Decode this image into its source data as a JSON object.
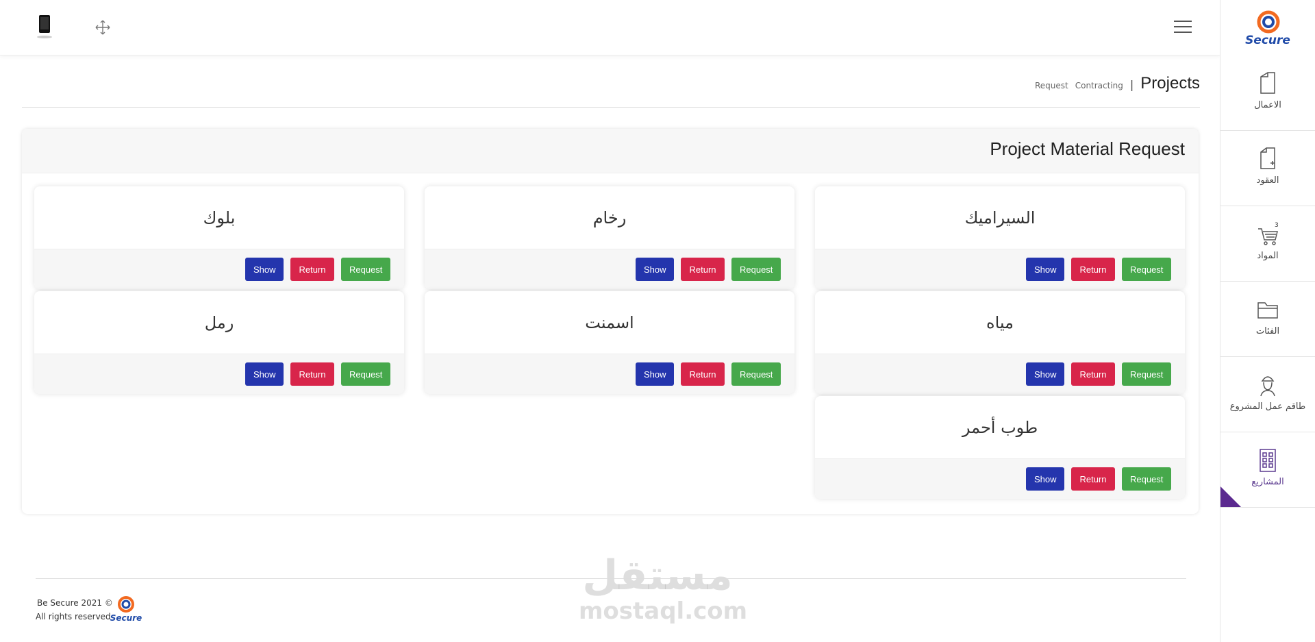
{
  "header": {
    "device_icon": "tablet-icon",
    "expand_icon": "fullscreen-icon",
    "menu_icon": "hamburger-icon"
  },
  "sidebar": {
    "logo_text": "Secure",
    "items": [
      {
        "label": "الاعمال",
        "icon": "document-icon"
      },
      {
        "label": "العقود",
        "icon": "add-document-icon"
      },
      {
        "label": "المواد",
        "icon": "cart-icon",
        "badge": "3"
      },
      {
        "label": "الفئات",
        "icon": "folder-icon"
      },
      {
        "label": "طاقم عمل المشروع",
        "icon": "worker-icon"
      },
      {
        "label": "المشاريع",
        "icon": "building-icon"
      }
    ]
  },
  "breadcrumb": {
    "items": [
      "Request",
      "Contracting"
    ],
    "separator": "|",
    "title": "Projects"
  },
  "main": {
    "title": "Project Material Request",
    "buttons": {
      "show": "Show",
      "return": "Return",
      "request": "Request"
    },
    "materials": [
      {
        "name": "السيراميك"
      },
      {
        "name": "رخام"
      },
      {
        "name": "بلوك"
      },
      {
        "name": "مياه"
      },
      {
        "name": "اسمنت"
      },
      {
        "name": "رمل"
      },
      {
        "name": "طوب أحمر"
      }
    ]
  },
  "footer": {
    "copyright": "Be Secure 2021 ©",
    "rights": "All rights reserved",
    "logo_text": "Secure"
  },
  "watermark": {
    "arabic": "مستقل",
    "latin": "mostaql.com"
  },
  "colors": {
    "request": "#46a84b",
    "return": "#d8254a",
    "show": "#2435ad",
    "brand_orange": "#f26a21",
    "brand_blue": "#1f4aa8",
    "accent_purple": "#5b2a8f"
  }
}
